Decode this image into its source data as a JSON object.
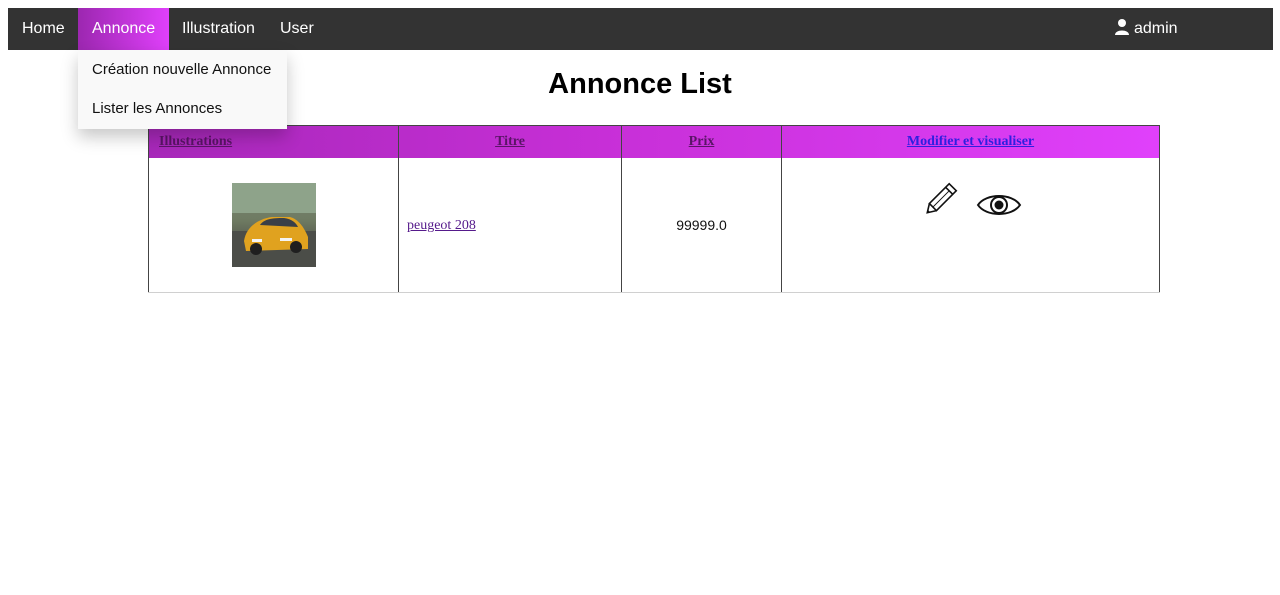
{
  "navbar": {
    "items": [
      {
        "label": "Home",
        "active": false
      },
      {
        "label": "Annonce",
        "active": true
      },
      {
        "label": "Illustration",
        "active": false
      },
      {
        "label": "User",
        "active": false
      }
    ],
    "user": {
      "icon": "user-icon",
      "name": "admin"
    }
  },
  "dropdown": {
    "items": [
      {
        "label": "Création nouvelle Annonce"
      },
      {
        "label": "Lister les Annonces"
      }
    ]
  },
  "page": {
    "title": "Annonce List"
  },
  "table": {
    "headers": [
      "Illustrations",
      "Titre",
      "Prix",
      "Modifier et visualiser"
    ],
    "rows": [
      {
        "image": "car-thumbnail",
        "titre": "peugeot 208",
        "prix": "99999.0",
        "actions": [
          "pencil-icon",
          "eye-icon"
        ]
      }
    ]
  },
  "colors": {
    "navbar": "#333333",
    "accent_start": "#9c27b0",
    "accent_end": "#e040fb"
  }
}
